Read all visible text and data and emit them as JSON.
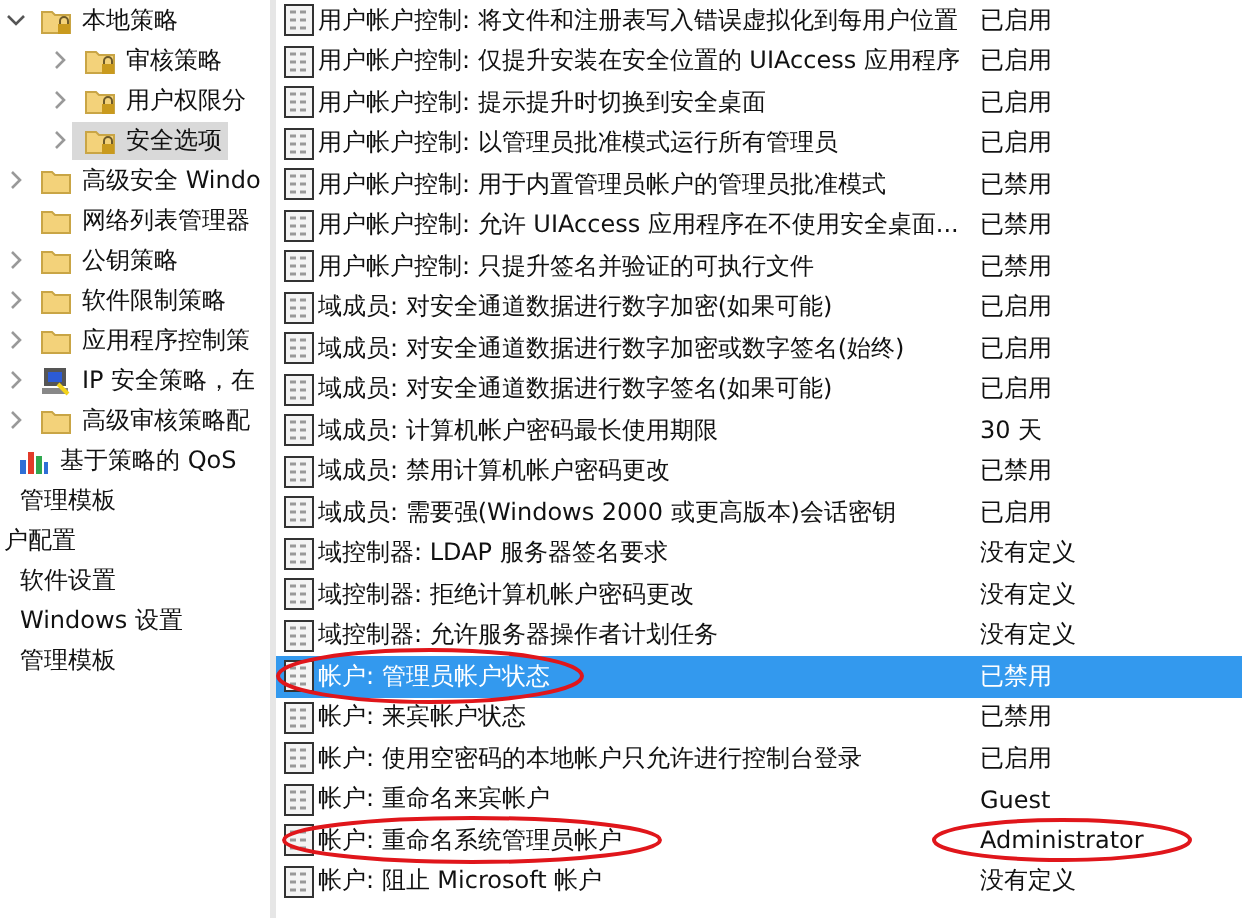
{
  "tree": {
    "security_items": [
      {
        "label": "本地策略",
        "kind": "locked_folder",
        "expanded": true,
        "selected": false,
        "children": [
          {
            "label": "审核策略",
            "kind": "locked_folder",
            "expanded": false,
            "selected": false
          },
          {
            "label": "用户权限分",
            "kind": "locked_folder",
            "expanded": false,
            "selected": false
          },
          {
            "label": "安全选项",
            "kind": "locked_folder",
            "expanded": false,
            "selected": true
          }
        ]
      },
      {
        "label": "高级安全 Windo",
        "kind": "folder",
        "expanded": false,
        "selected": false
      },
      {
        "label": "网络列表管理器",
        "kind": "folder",
        "selected": false
      },
      {
        "label": "公钥策略",
        "kind": "folder",
        "expanded": false,
        "selected": false
      },
      {
        "label": "软件限制策略",
        "kind": "folder",
        "expanded": false,
        "selected": false
      },
      {
        "label": "应用程序控制策",
        "kind": "folder",
        "expanded": false,
        "selected": false
      },
      {
        "label": "IP 安全策略，在",
        "kind": "ip_policy",
        "expanded": false,
        "selected": false
      },
      {
        "label": "高级审核策略配",
        "kind": "folder",
        "expanded": false,
        "selected": false
      }
    ],
    "windows_settings_items": [
      {
        "label": "基于策略的 QoS",
        "kind": "chart",
        "selected": false
      }
    ],
    "computer_config_items": [
      {
        "label": "管理模板",
        "selected": false
      }
    ],
    "user_config": {
      "label": "户配置",
      "selected": false,
      "children": [
        {
          "label": "软件设置",
          "selected": false
        },
        {
          "label": "Windows 设置",
          "selected": false
        },
        {
          "label": "管理模板",
          "selected": false
        }
      ]
    }
  },
  "policies": [
    {
      "policy": "用户帐户控制: 将文件和注册表写入错误虚拟化到每用户位置",
      "setting": "已启用",
      "selected": false
    },
    {
      "policy": "用户帐户控制: 仅提升安装在安全位置的 UIAccess 应用程序",
      "setting": "已启用",
      "selected": false
    },
    {
      "policy": "用户帐户控制: 提示提升时切换到安全桌面",
      "setting": "已启用",
      "selected": false
    },
    {
      "policy": "用户帐户控制: 以管理员批准模式运行所有管理员",
      "setting": "已启用",
      "selected": false
    },
    {
      "policy": "用户帐户控制: 用于内置管理员帐户的管理员批准模式",
      "setting": "已禁用",
      "selected": false
    },
    {
      "policy": "用户帐户控制: 允许 UIAccess 应用程序在不使用安全桌面...",
      "setting": "已禁用",
      "selected": false
    },
    {
      "policy": "用户帐户控制: 只提升签名并验证的可执行文件",
      "setting": "已禁用",
      "selected": false
    },
    {
      "policy": "域成员: 对安全通道数据进行数字加密(如果可能)",
      "setting": "已启用",
      "selected": false
    },
    {
      "policy": "域成员: 对安全通道数据进行数字加密或数字签名(始终)",
      "setting": "已启用",
      "selected": false
    },
    {
      "policy": "域成员: 对安全通道数据进行数字签名(如果可能)",
      "setting": "已启用",
      "selected": false
    },
    {
      "policy": "域成员: 计算机帐户密码最长使用期限",
      "setting": "30 天",
      "selected": false
    },
    {
      "policy": "域成员: 禁用计算机帐户密码更改",
      "setting": "已禁用",
      "selected": false
    },
    {
      "policy": "域成员: 需要强(Windows 2000 或更高版本)会话密钥",
      "setting": "已启用",
      "selected": false
    },
    {
      "policy": "域控制器: LDAP 服务器签名要求",
      "setting": "没有定义",
      "selected": false
    },
    {
      "policy": "域控制器: 拒绝计算机帐户密码更改",
      "setting": "没有定义",
      "selected": false
    },
    {
      "policy": "域控制器: 允许服务器操作者计划任务",
      "setting": "没有定义",
      "selected": false
    },
    {
      "policy": "帐户: 管理员帐户状态",
      "setting": "已禁用",
      "selected": true
    },
    {
      "policy": "帐户: 来宾帐户状态",
      "setting": "已禁用",
      "selected": false
    },
    {
      "policy": "帐户: 使用空密码的本地帐户只允许进行控制台登录",
      "setting": "已启用",
      "selected": false
    },
    {
      "policy": "帐户: 重命名来宾帐户",
      "setting": "Guest",
      "selected": false
    },
    {
      "policy": "帐户: 重命名系统管理员帐户",
      "setting": "Administrator",
      "selected": false
    },
    {
      "policy": "帐户: 阻止 Microsoft 帐户",
      "setting": "没有定义",
      "selected": false
    }
  ]
}
